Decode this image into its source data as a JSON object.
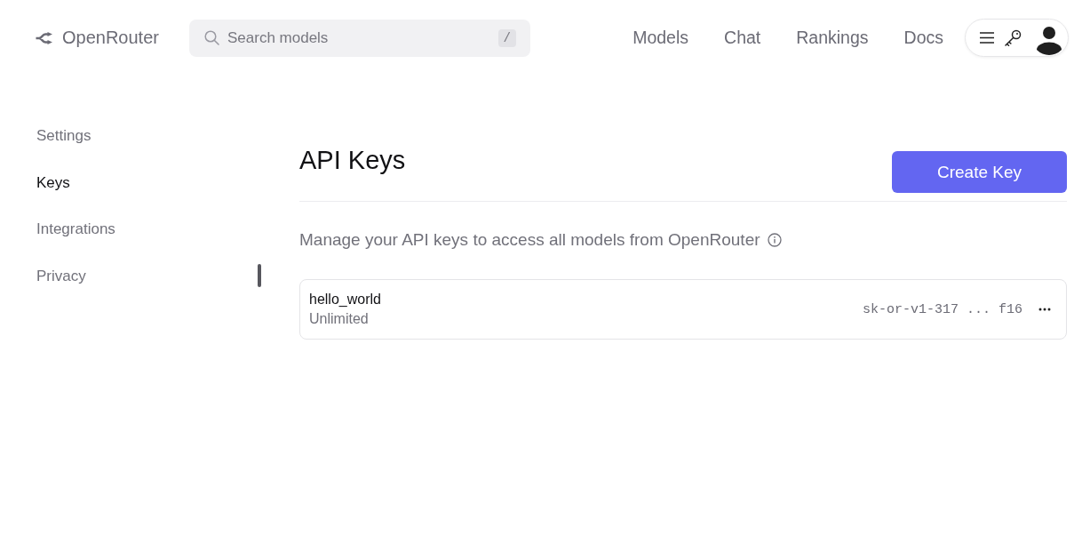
{
  "header": {
    "logo": "OpenRouter",
    "search": {
      "placeholder": "Search models",
      "shortcut": "/"
    },
    "nav": [
      "Models",
      "Chat",
      "Rankings",
      "Docs"
    ]
  },
  "sidebar": {
    "items": [
      {
        "label": "Settings",
        "selected": false
      },
      {
        "label": "Keys",
        "selected": true
      },
      {
        "label": "Integrations",
        "selected": false
      },
      {
        "label": "Privacy",
        "selected": false
      }
    ]
  },
  "page": {
    "title": "API Keys",
    "create_button": "Create Key",
    "description": "Manage your API keys to access all models from OpenRouter",
    "keys": [
      {
        "name": "hello_world",
        "limit": "Unlimited",
        "key": "sk-or-v1-317 ... f16"
      }
    ]
  }
}
